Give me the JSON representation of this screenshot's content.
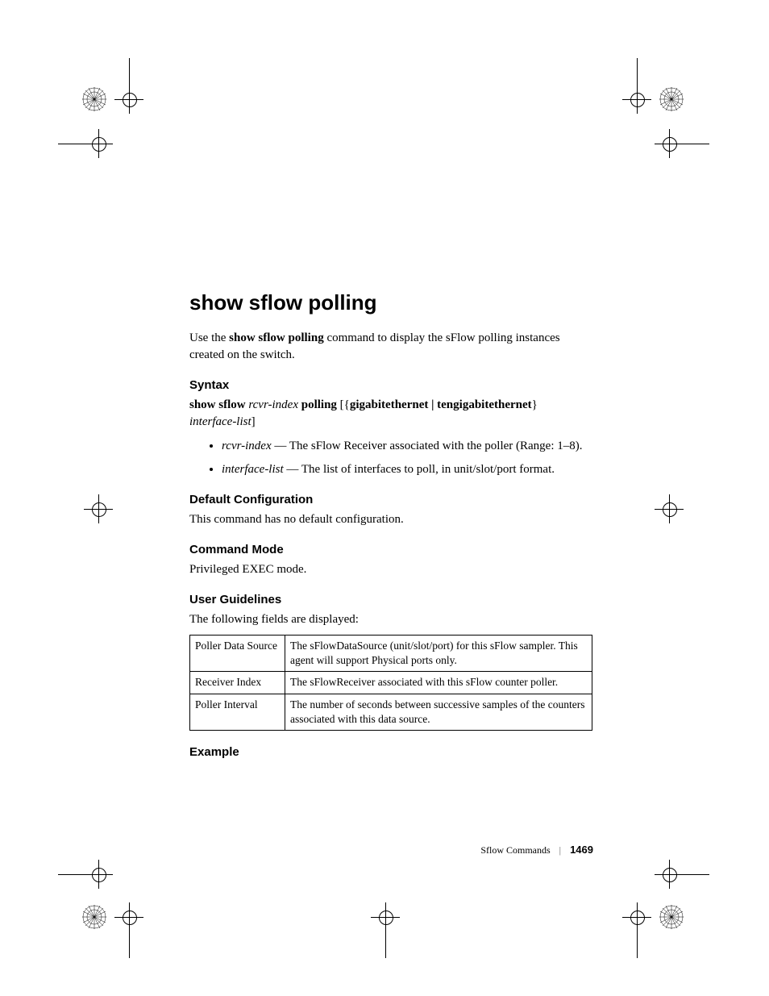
{
  "heading": "show sflow polling",
  "intro_pre": "Use the ",
  "intro_bold": "show sflow polling",
  "intro_post": " command to display the sFlow polling instances created on the switch.",
  "syntax_heading": "Syntax",
  "syntax": {
    "p1_bold1": "show sflow ",
    "p1_italic1": "rcvr-index",
    "p1_bold2": " polling ",
    "p1_plain1": "[{",
    "p1_bold3": "gigabitethernet | tengigabitethernet",
    "p1_plain2": "}",
    "p2_italic": "interface-list",
    "p2_plain": "]"
  },
  "bullets": [
    {
      "term": "rcvr-index",
      "desc": " — The sFlow Receiver associated with the poller (Range: 1–8)."
    },
    {
      "term": "interface-list",
      "desc": " — The list of interfaces to poll, in unit/slot/port format."
    }
  ],
  "default_cfg_heading": "Default Configuration",
  "default_cfg_text": "This command has no default configuration.",
  "cmd_mode_heading": "Command Mode",
  "cmd_mode_text": "Privileged EXEC mode.",
  "user_guidelines_heading": "User Guidelines",
  "user_guidelines_text": "The following fields are displayed:",
  "table": [
    {
      "field": "Poller Data Source",
      "desc": "The sFlowDataSource (unit/slot/port) for this sFlow sampler.  This agent will support Physical ports only."
    },
    {
      "field": "Receiver Index",
      "desc": "The sFlowReceiver associated with this sFlow counter poller."
    },
    {
      "field": "Poller Interval",
      "desc": "The number of seconds between successive samples of the counters associated with this data source."
    }
  ],
  "example_heading": "Example",
  "footer_section": "Sflow Commands",
  "footer_page": "1469"
}
